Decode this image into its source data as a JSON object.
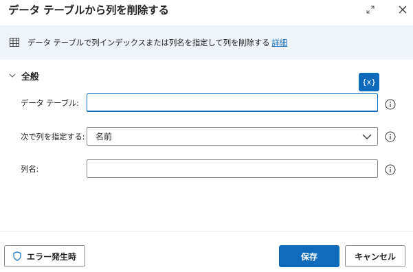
{
  "dialog": {
    "title": "データ テーブルから列を削除する",
    "expand_icon": "expand-diagonal-icon",
    "close_icon": "close-icon"
  },
  "info": {
    "icon": "table-icon",
    "text": "データ テーブルで列インデックスまたは列名を指定して列を削除する",
    "link": "詳細"
  },
  "section": {
    "title": "全般",
    "expanded": true
  },
  "variable_button": {
    "label": "{x}"
  },
  "fields": {
    "datatable": {
      "label": "データ テーブル:",
      "value": ""
    },
    "specify_by": {
      "label": "次で列を指定する:",
      "value": "名前"
    },
    "column_name": {
      "label": "列名:",
      "value": ""
    }
  },
  "footer": {
    "on_error": "エラー発生時",
    "save": "保存",
    "cancel": "キャンセル"
  },
  "colors": {
    "accent": "#0f6cbd",
    "banner_bg": "#eff4fa",
    "text": "#242424"
  }
}
